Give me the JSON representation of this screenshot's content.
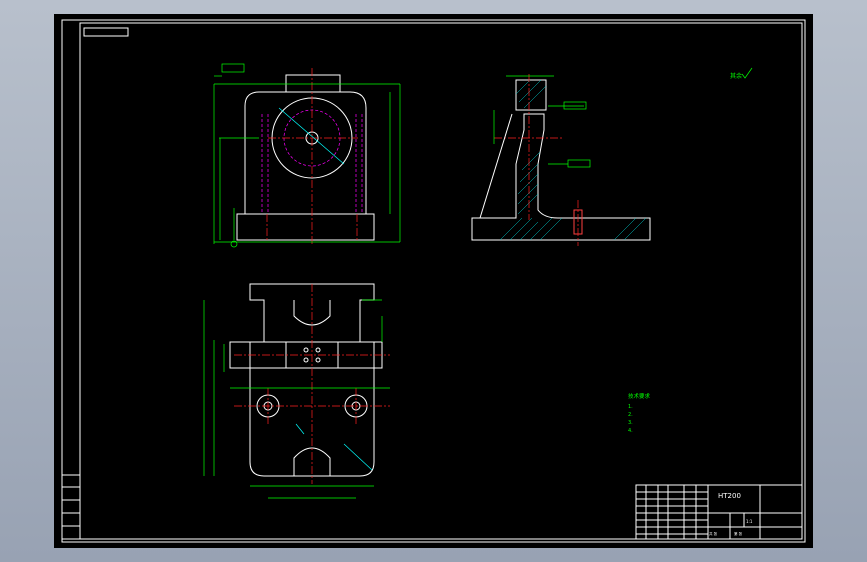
{
  "colors": {
    "background": "#000000",
    "viewport": "#a7b0c0",
    "outline": "#ffffff",
    "dimension": "#00ff00",
    "centerline": "#ff2020",
    "hidden": "#ff00ff",
    "hatch": "#00cccc"
  },
  "drawing": {
    "title_block": {
      "material": "HT200",
      "part_name": "",
      "drawing_name": "",
      "scale": "1:1",
      "sheet": "",
      "labels": [
        "标记",
        "处数",
        "分区",
        "更改文件号",
        "签名",
        "年月日",
        "设计",
        "标准化",
        "阶段标记",
        "重量",
        "比例",
        "审核",
        "工艺",
        "批准",
        "共 张",
        "第 张"
      ]
    },
    "tech_requirements": {
      "title": "技术要求",
      "lines": [
        "1.",
        "2.",
        "3.",
        "4."
      ]
    },
    "roughness_note": "其余",
    "left_table_rows": [
      "",
      "",
      "",
      "",
      ""
    ]
  }
}
